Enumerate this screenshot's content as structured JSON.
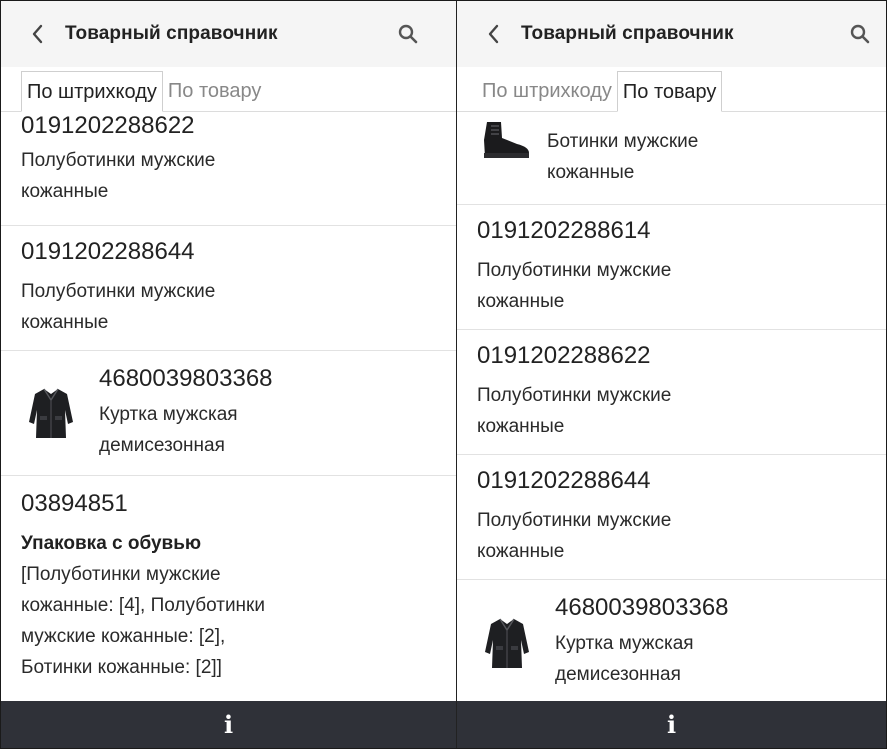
{
  "left": {
    "title": "Товарный справочник",
    "tabs": [
      "По штрихкоду",
      "По товару"
    ],
    "active_tab": 0,
    "items": [
      {
        "code": "0191202288622",
        "desc1": "Полуботинки мужские",
        "desc2": "кожанные"
      },
      {
        "code": "0191202288644",
        "desc1": "Полуботинки мужские",
        "desc2": "кожанные"
      },
      {
        "code": "4680039803368",
        "desc1": "Куртка мужская",
        "desc2": "демисезонная",
        "image": "jacket-icon"
      },
      {
        "code": "03894851",
        "bold": "Упаковка с обувью",
        "lines": [
          "[Полуботинки мужские",
          "кожанные: [4], Полуботинки",
          "мужские кожанные: [2],",
          "Ботинки кожанные: [2]]"
        ]
      }
    ],
    "info_label": "i"
  },
  "right": {
    "title": "Товарный справочник",
    "tabs": [
      "По штрихкоду",
      "По товару"
    ],
    "active_tab": 1,
    "items": [
      {
        "desc1": "Ботинки мужские",
        "desc2": "кожанные",
        "image": "boot-icon"
      },
      {
        "code": "0191202288614",
        "desc1": "Полуботинки мужские",
        "desc2": "кожанные"
      },
      {
        "code": "0191202288622",
        "desc1": "Полуботинки мужские",
        "desc2": "кожанные"
      },
      {
        "code": "0191202288644",
        "desc1": "Полуботинки мужские",
        "desc2": "кожанные"
      },
      {
        "code": "4680039803368",
        "desc1": "Куртка мужская",
        "desc2": "демисезонная",
        "image": "jacket-icon"
      }
    ],
    "info_label": "i"
  },
  "colors": {
    "appbar": "#f5f5f5",
    "bottombar": "#2f3138",
    "divider": "#e2e2e2"
  }
}
